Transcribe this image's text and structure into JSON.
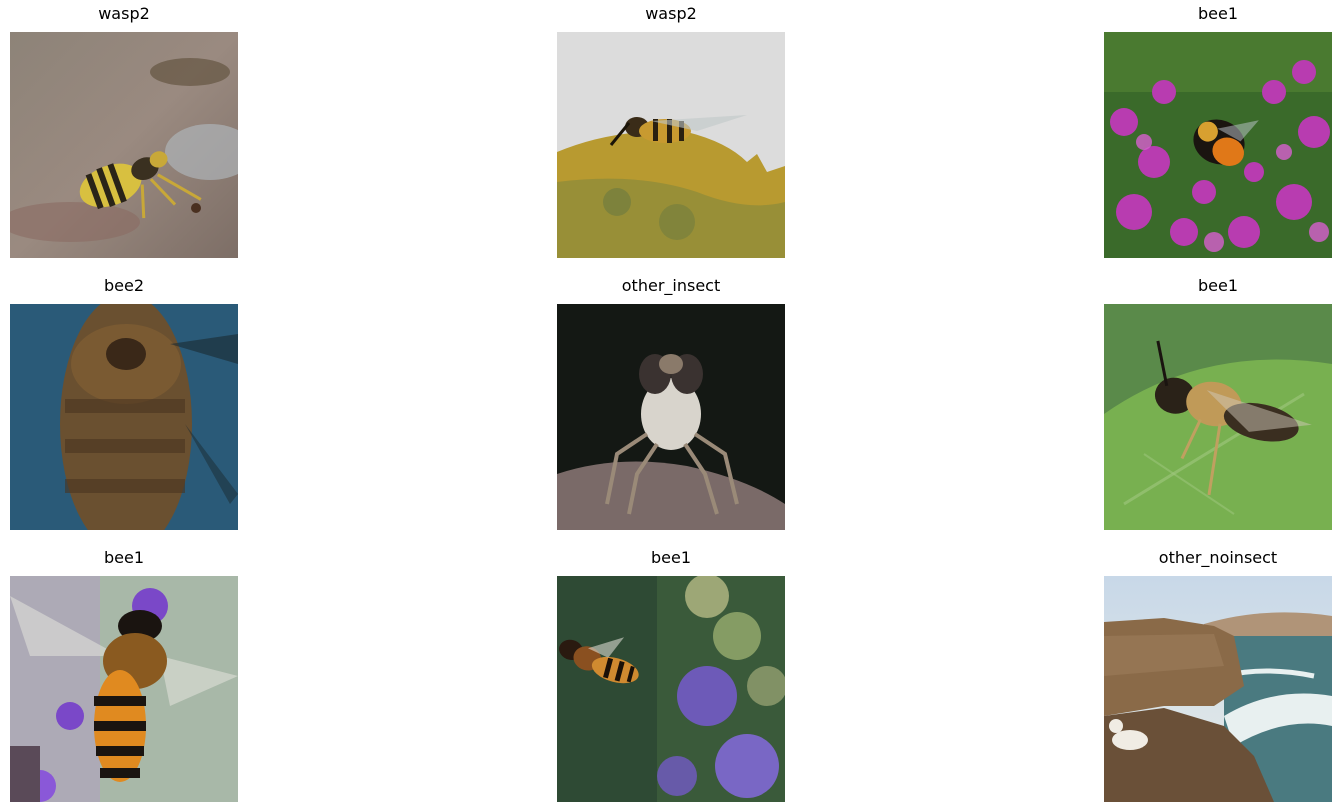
{
  "grid": {
    "panels": [
      {
        "label": "wasp2",
        "subject": "wasp on wet pavement"
      },
      {
        "label": "wasp2",
        "subject": "wasp on a leaf edge"
      },
      {
        "label": "bee1",
        "subject": "bumblebee on purple heather"
      },
      {
        "label": "bee2",
        "subject": "blurred bee abdomen"
      },
      {
        "label": "other_insect",
        "subject": "robber fly front view"
      },
      {
        "label": "bee1",
        "subject": "bee on green leaf"
      },
      {
        "label": "bee1",
        "subject": "honeybee close-up with lavender"
      },
      {
        "label": "bee1",
        "subject": "honeybee flying near flowers"
      },
      {
        "label": "other_noinsect",
        "subject": "coastal cliffs with dog"
      }
    ]
  },
  "colors": {
    "background": "#ffffff",
    "title": "#000000"
  }
}
